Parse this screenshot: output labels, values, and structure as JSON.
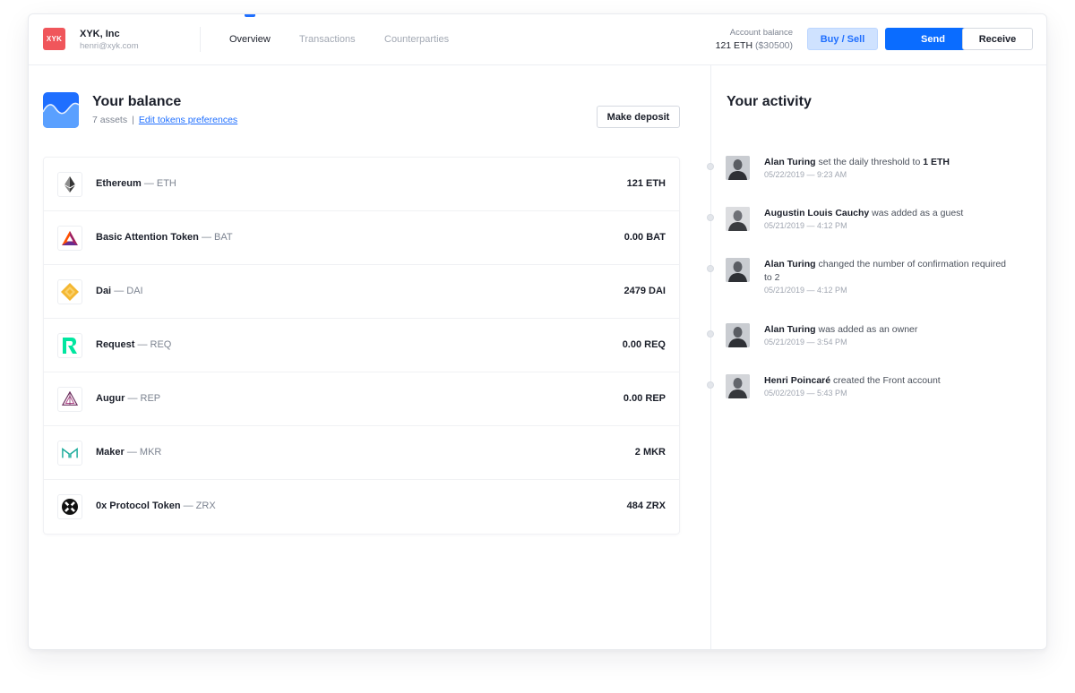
{
  "org": {
    "logo_text": "XYK",
    "name": "XYK, Inc",
    "email": "henri@xyk.com",
    "logo_color": "#f0565b"
  },
  "nav": {
    "tabs": [
      {
        "label": "Overview",
        "active": true
      },
      {
        "label": "Transactions",
        "active": false
      },
      {
        "label": "Counterparties",
        "active": false
      }
    ]
  },
  "account": {
    "label": "Account balance",
    "value": "121 ETH",
    "fiat": "($30500)"
  },
  "actions": {
    "buy_sell": "Buy / Sell",
    "send": "Send",
    "receive": "Receive"
  },
  "balance": {
    "title": "Your balance",
    "assets_count": "7 assets",
    "separator": "|",
    "edit_link": "Edit tokens preferences",
    "deposit_button": "Make deposit",
    "assets": [
      {
        "name": "Ethereum",
        "dash": "—",
        "symbol": "ETH",
        "amount": "121 ETH",
        "icon": "ethereum-icon"
      },
      {
        "name": "Basic Attention Token",
        "dash": "—",
        "symbol": "BAT",
        "amount": "0.00 BAT",
        "icon": "bat-icon"
      },
      {
        "name": "Dai",
        "dash": "—",
        "symbol": "DAI",
        "amount": "2479 DAI",
        "icon": "dai-icon"
      },
      {
        "name": "Request",
        "dash": "—",
        "symbol": "REQ",
        "amount": "0.00 REQ",
        "icon": "request-icon"
      },
      {
        "name": "Augur",
        "dash": "—",
        "symbol": "REP",
        "amount": "0.00 REP",
        "icon": "augur-icon"
      },
      {
        "name": "Maker",
        "dash": "—",
        "symbol": "MKR",
        "amount": "2 MKR",
        "icon": "maker-icon"
      },
      {
        "name": "0x Protocol Token",
        "dash": "—",
        "symbol": "ZRX",
        "amount": "484 ZRX",
        "icon": "zrx-icon"
      }
    ]
  },
  "activity": {
    "title": "Your activity",
    "items": [
      {
        "who": "Alan Turing",
        "text": " set the daily threshold to ",
        "emphasis": "1 ETH",
        "time": "05/22/2019 — 9:23 AM"
      },
      {
        "who": "Augustin Louis Cauchy",
        "text": " was added as a guest",
        "emphasis": "",
        "time": "05/21/2019 — 4:12 PM"
      },
      {
        "who": "Alan Turing",
        "text": " changed the number of confirmation required to 2",
        "emphasis": "",
        "time": "05/21/2019 — 4:12 PM"
      },
      {
        "who": "Alan Turing",
        "text": " was added as an owner",
        "emphasis": "",
        "time": "05/21/2019 — 3:54 PM"
      },
      {
        "who": "Henri Poincaré",
        "text": " created the Front account",
        "emphasis": "",
        "time": "05/02/2019 — 5:43 PM"
      }
    ]
  },
  "colors": {
    "accent": "#0a6cff",
    "accent_light": "#cfe2ff"
  }
}
